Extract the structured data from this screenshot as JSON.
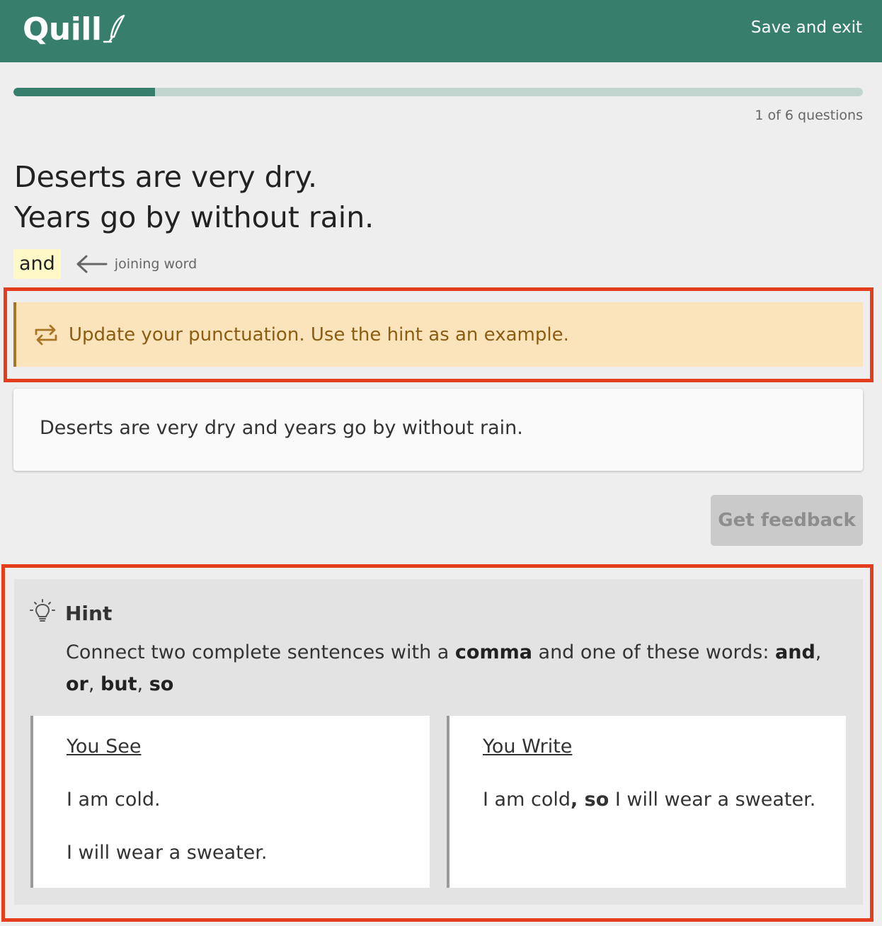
{
  "header": {
    "logo_text": "Quill",
    "save_exit_label": "Save and exit",
    "background_color": "#377f6c"
  },
  "progress": {
    "completed": 1,
    "total": 6,
    "fraction_filled": 0.1667,
    "label": "1 of 6 questions"
  },
  "prompt": {
    "sentence_1": "Deserts are very dry.",
    "sentence_2": "Years go by without rain.",
    "joining_word": "and",
    "joining_word_hint_icon": "arrow-left-icon",
    "joining_word_label": "joining word"
  },
  "feedback": {
    "icon": "repeat-arrows-icon",
    "message": "Update your punctuation. Use the hint as an example.",
    "background_color": "#fbe4bc",
    "text_color": "#8a5d12"
  },
  "answer": {
    "text": "Deserts are very dry and years go by without rain."
  },
  "actions": {
    "get_feedback_label": "Get feedback",
    "get_feedback_disabled": true
  },
  "hint": {
    "icon": "lightbulb-icon",
    "title": "Hint",
    "body_part_1": "Connect two complete sentences with a ",
    "body_bold_1": "comma",
    "body_part_2": " and one of these words: ",
    "word_1": "and",
    "sep_1": ", ",
    "word_2": "or",
    "sep_2": ", ",
    "word_3": "but",
    "sep_3": ", ",
    "word_4": "so",
    "you_see": {
      "title": "You See",
      "line_1": "I am cold.",
      "line_2": "I will wear a sweater."
    },
    "you_write": {
      "title": "You Write",
      "before": "I am cold",
      "bold": ", so",
      "after": " I will wear a sweater."
    }
  },
  "highlight_color": "#e53e1f"
}
